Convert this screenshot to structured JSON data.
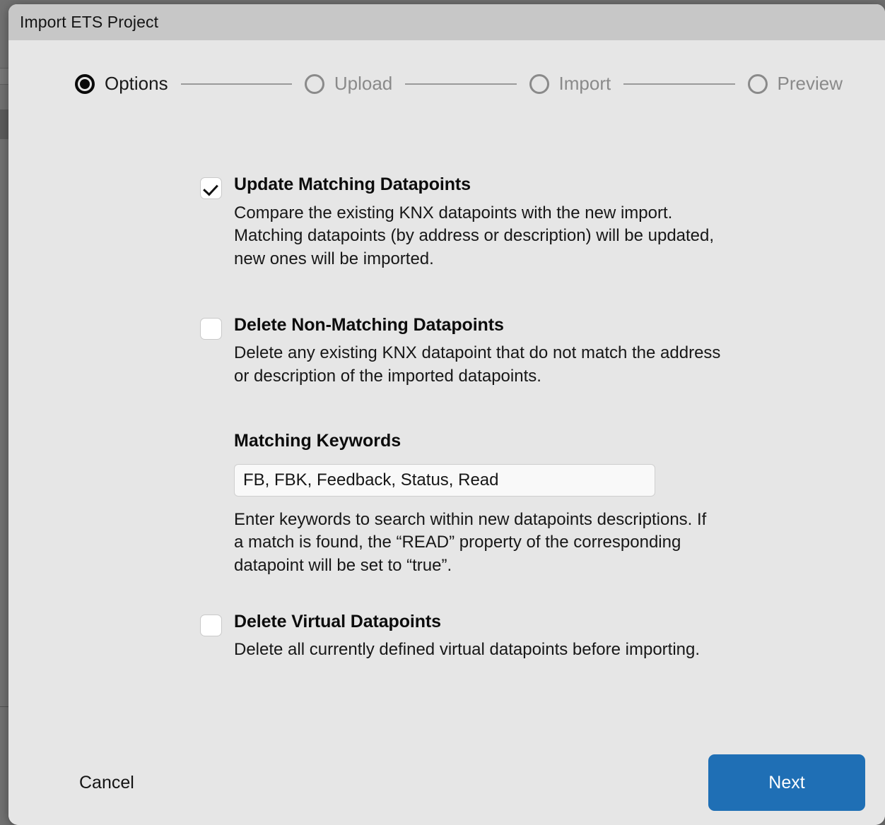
{
  "window": {
    "title": "Import ETS Project"
  },
  "stepper": {
    "steps": [
      {
        "label": "Options",
        "state": "active"
      },
      {
        "label": "Upload",
        "state": "inactive"
      },
      {
        "label": "Import",
        "state": "inactive"
      },
      {
        "label": "Preview",
        "state": "inactive"
      }
    ]
  },
  "options": [
    {
      "title": "Update Matching Datapoints",
      "description": "Compare the existing KNX datapoints with the new import. Matching datapoints (by address or description) will be updated, new ones will be imported.",
      "checked": true
    },
    {
      "title": "Delete Non-Matching Datapoints",
      "description": "Delete any existing KNX datapoint that do not match the address or description of the imported datapoints.",
      "checked": false
    },
    {
      "title": "Delete Virtual Datapoints",
      "description": "Delete all currently defined virtual datapoints before importing.",
      "checked": false
    }
  ],
  "keywords": {
    "label": "Matching Keywords",
    "value": "FB, FBK, Feedback, Status, Read",
    "placeholder": "FB, FBK, Feedback, Status, Read",
    "description": "Enter keywords to search within new datapoints descriptions. If a match is found, the “READ” property of the corresponding datapoint will be set to “true”."
  },
  "footer": {
    "cancel_label": "Cancel",
    "next_label": "Next"
  },
  "colors": {
    "primary": "#1f6fb5",
    "dialog_background": "#e6e6e6",
    "titlebar_background": "#c7c7c7",
    "inactive_step": "#8a8a8a"
  }
}
